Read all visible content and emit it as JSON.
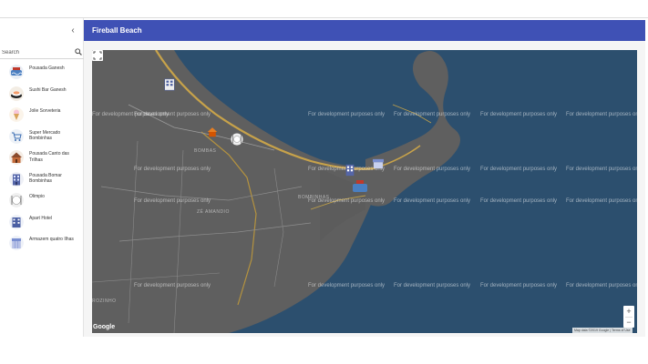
{
  "header": {
    "title": "Fireball Beach"
  },
  "sidebar": {
    "collapse_icon": "chevron-left-icon",
    "search": {
      "placeholder": "Search",
      "value": ""
    },
    "items": [
      {
        "label": "Pousada Ganesh",
        "icon": "pool-icon"
      },
      {
        "label": "Sushi Bar Ganesh",
        "icon": "sushi-icon"
      },
      {
        "label": "Jolie Sorveteria",
        "icon": "ice-cream-icon"
      },
      {
        "label": "Super Mercado Bombinhas",
        "icon": "shopping-cart-icon"
      },
      {
        "label": "Pousada Canto das Trilhas",
        "icon": "house-icon"
      },
      {
        "label": "Pousada Bomar Bombinhas",
        "icon": "building-icon"
      },
      {
        "label": "Olimpio",
        "icon": "restaurant-icon"
      },
      {
        "label": "Apart Hotel",
        "icon": "hotel-icon"
      },
      {
        "label": "Armazem quatro Ilhas",
        "icon": "store-icon"
      }
    ]
  },
  "map": {
    "watermark": "For development purposes only",
    "districts": [
      "BOMBAS",
      "ZÉ AMANDIO",
      "BOMBINHAS",
      "ROZINHO"
    ],
    "attribution": "Map data ©2019 Google  |  Terms of Use",
    "logo": "Google",
    "zoom_in": "+",
    "zoom_out": "−",
    "colors": {
      "water": "#2c4f6e",
      "land": "#5e5e5e",
      "roads": "#c7a24a",
      "header": "#3f51b5"
    }
  }
}
